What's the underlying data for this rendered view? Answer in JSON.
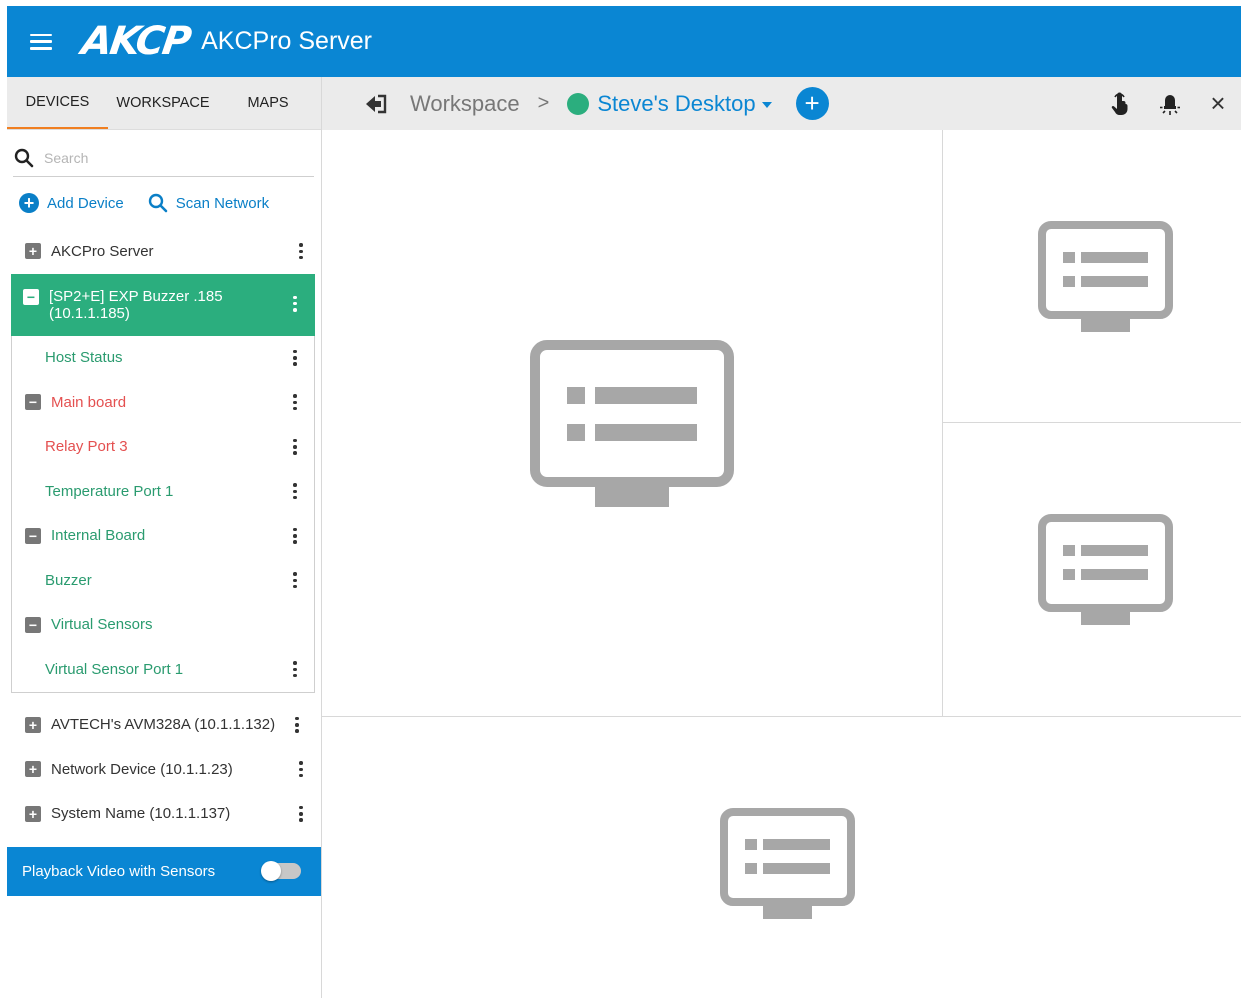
{
  "header": {
    "logo": "AKCP",
    "title": "AKCPro Server"
  },
  "tabs": [
    "DEVICES",
    "WORKSPACE",
    "MAPS"
  ],
  "search": {
    "placeholder": "Search"
  },
  "actions": {
    "add_device": "Add Device",
    "scan_network": "Scan Network"
  },
  "tree": {
    "top": {
      "label": "AKCPro Server",
      "indicator": "+"
    },
    "selected": {
      "line1": "[SP2+E] EXP Buzzer .185",
      "line2": "(10.1.1.185)",
      "indicator": "−"
    },
    "children": [
      {
        "label": "Host Status",
        "color": "green",
        "indicator": ""
      },
      {
        "label": "Main board",
        "color": "red",
        "indicator": "−"
      },
      {
        "label": "Relay Port 3",
        "color": "red",
        "indicator": ""
      },
      {
        "label": "Temperature Port 1",
        "color": "green",
        "indicator": ""
      },
      {
        "label": "Internal Board",
        "color": "green",
        "indicator": "−"
      },
      {
        "label": "Buzzer",
        "color": "green",
        "indicator": ""
      },
      {
        "label": "Virtual Sensors",
        "color": "green",
        "indicator": "−"
      },
      {
        "label": "Virtual Sensor Port 1",
        "color": "green",
        "indicator": ""
      }
    ],
    "others": [
      {
        "label": "AVTECH's AVM328A (10.1.1.132)",
        "indicator": "+"
      },
      {
        "label": "Network Device (10.1.1.23)",
        "indicator": "+"
      },
      {
        "label": "System Name (10.1.1.137)",
        "indicator": "+"
      }
    ]
  },
  "playback": {
    "label": "Playback Video with Sensors",
    "enabled": false
  },
  "workspace": {
    "crumb": "Workspace",
    "separator": ">",
    "desktop": "Steve's Desktop",
    "add": "+",
    "close": "×"
  },
  "colors": {
    "primary": "#0a86d3",
    "selected": "#2bae7e",
    "green_text": "#2a9b6f",
    "red_text": "#e45050",
    "tab_underline": "#f07f21"
  },
  "icons": [
    "menu-icon",
    "back-icon",
    "touch-icon",
    "light-icon",
    "close-icon",
    "monitor-icon",
    "search-icon",
    "scan-icon"
  ]
}
